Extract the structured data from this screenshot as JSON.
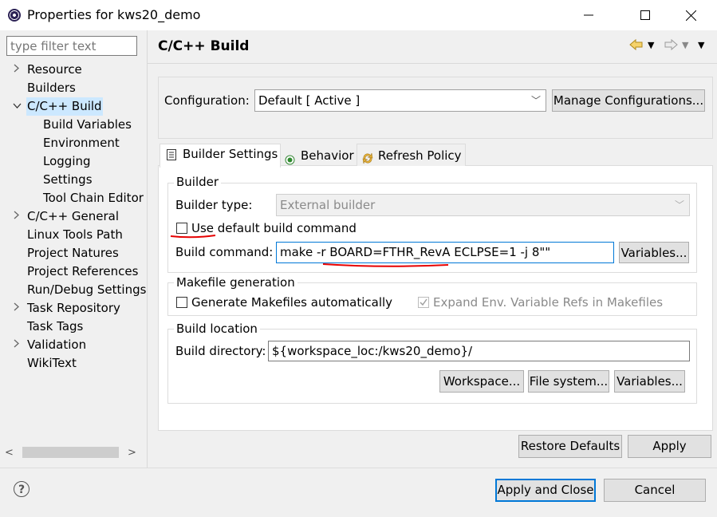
{
  "window": {
    "title": "Properties for kws20_demo",
    "minimize_glyph": "—",
    "maximize_glyph": "☐",
    "close_glyph": "✕"
  },
  "filter": {
    "placeholder": "type filter text"
  },
  "tree": [
    {
      "label": "Resource",
      "twisty": ">",
      "indent": 0
    },
    {
      "label": "Builders",
      "twisty": "",
      "indent": 0
    },
    {
      "label": "C/C++ Build",
      "twisty": "v",
      "indent": 0,
      "selected": true
    },
    {
      "label": "Build Variables",
      "twisty": "",
      "indent": 1
    },
    {
      "label": "Environment",
      "twisty": "",
      "indent": 1
    },
    {
      "label": "Logging",
      "twisty": "",
      "indent": 1
    },
    {
      "label": "Settings",
      "twisty": "",
      "indent": 1
    },
    {
      "label": "Tool Chain Editor",
      "twisty": "",
      "indent": 1
    },
    {
      "label": "C/C++ General",
      "twisty": ">",
      "indent": 0
    },
    {
      "label": "Linux Tools Path",
      "twisty": "",
      "indent": 0
    },
    {
      "label": "Project Natures",
      "twisty": "",
      "indent": 0
    },
    {
      "label": "Project References",
      "twisty": "",
      "indent": 0
    },
    {
      "label": "Run/Debug Settings",
      "twisty": "",
      "indent": 0
    },
    {
      "label": "Task Repository",
      "twisty": ">",
      "indent": 0
    },
    {
      "label": "Task Tags",
      "twisty": "",
      "indent": 0
    },
    {
      "label": "Validation",
      "twisty": ">",
      "indent": 0
    },
    {
      "label": "WikiText",
      "twisty": "",
      "indent": 0
    }
  ],
  "page": {
    "title": "C/C++ Build",
    "configuration_label": "Configuration:",
    "configuration_value": "Default  [ Active ]",
    "manage_configurations": "Manage Configurations...",
    "tabs": [
      {
        "label": "Builder Settings",
        "icon": "list-icon",
        "active": true
      },
      {
        "label": "Behavior",
        "icon": "radio-icon",
        "active": false
      },
      {
        "label": "Refresh Policy",
        "icon": "refresh-icon",
        "active": false
      }
    ],
    "builder": {
      "group_label": "Builder",
      "type_label": "Builder type:",
      "type_value": "External builder",
      "use_default_label": "Use default build command",
      "use_default_checked": false,
      "command_label": "Build command:",
      "command_value": "make -r BOARD=FTHR_RevA ECLPSE=1 -j 8\"\"",
      "variables_button": "Variables..."
    },
    "makefile": {
      "group_label": "Makefile generation",
      "generate_label": "Generate Makefiles automatically",
      "generate_checked": false,
      "expand_label": "Expand Env. Variable Refs in Makefiles",
      "expand_checked": true
    },
    "location": {
      "group_label": "Build location",
      "directory_label": "Build directory:",
      "directory_value": "${workspace_loc:/kws20_demo}/",
      "workspace_button": "Workspace...",
      "filesystem_button": "File system...",
      "variables_button": "Variables..."
    },
    "restore_defaults": "Restore Defaults",
    "apply": "Apply"
  },
  "footer": {
    "help_glyph": "?",
    "apply_and_close": "Apply and Close",
    "cancel": "Cancel"
  },
  "colors": {
    "annotation_red": "#e60000",
    "selection": "#cce8ff",
    "focus_blue": "#0078d7"
  }
}
